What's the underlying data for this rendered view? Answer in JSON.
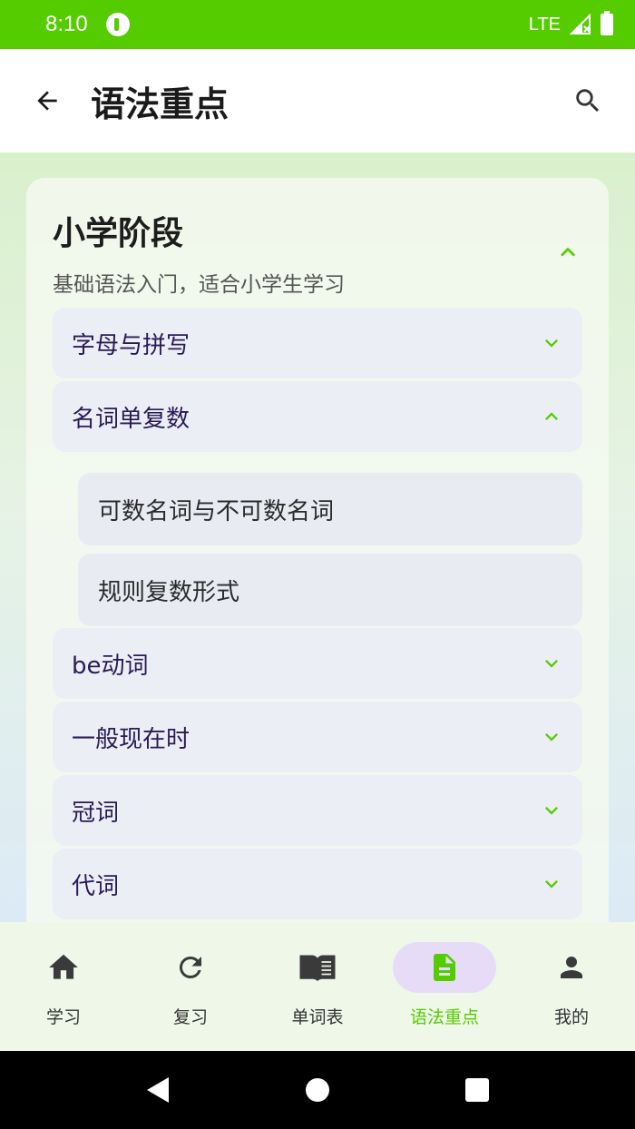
{
  "status_bar": {
    "time": "8:10",
    "network": "LTE"
  },
  "app_bar": {
    "title": "语法重点"
  },
  "stage": {
    "title": "小学阶段",
    "subtitle": "基础语法入门，适合小学生学习",
    "expanded": true
  },
  "topics": [
    {
      "label": "字母与拼写",
      "expanded": false
    },
    {
      "label": "名词单复数",
      "expanded": true
    },
    {
      "label": "be动词",
      "expanded": false
    },
    {
      "label": "一般现在时",
      "expanded": false
    },
    {
      "label": "冠词",
      "expanded": false
    },
    {
      "label": "代词",
      "expanded": false
    }
  ],
  "subtopics": [
    {
      "label": "可数名词与不可数名词"
    },
    {
      "label": "规则复数形式"
    }
  ],
  "bottom_nav": {
    "items": [
      {
        "label": "学习",
        "icon": "home-icon"
      },
      {
        "label": "复习",
        "icon": "refresh-icon"
      },
      {
        "label": "单词表",
        "icon": "book-icon"
      },
      {
        "label": "语法重点",
        "icon": "document-icon",
        "active": true
      },
      {
        "label": "我的",
        "icon": "person-icon"
      }
    ]
  },
  "colors": {
    "accent": "#55cc00",
    "status_bar": "#55cc00",
    "active_pill": "#e6dcf8",
    "topic_text": "#2a1a55"
  }
}
